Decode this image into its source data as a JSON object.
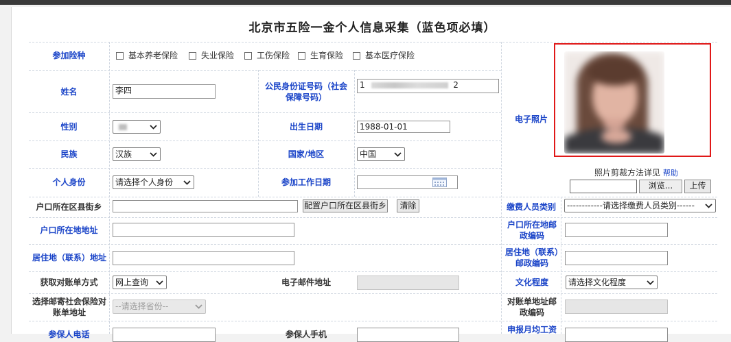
{
  "title": "北京市五险一金个人信息采集（蓝色项必填）",
  "insurance": {
    "label": "参加险种",
    "options": [
      "基本养老保险",
      "失业保险",
      "工伤保险",
      "生育保险",
      "基本医疗保险"
    ]
  },
  "name": {
    "label": "姓名",
    "value": "李四"
  },
  "id_number": {
    "label": "公民身份证号码（社会保障号码）",
    "value_start": "1",
    "value_end": "2"
  },
  "photo": {
    "label": "电子照片",
    "crop_hint": "照片剪裁方法详见",
    "help": "帮助",
    "browse": "浏览...",
    "upload": "上传"
  },
  "gender": {
    "label": "性别",
    "value": ""
  },
  "birth_date": {
    "label": "出生日期",
    "value": "1988-01-01"
  },
  "ethnicity": {
    "label": "民族",
    "value": "汉族"
  },
  "country": {
    "label": "国家/地区",
    "value": "中国"
  },
  "identity": {
    "label": "个人身份",
    "value": "请选择个人身份"
  },
  "work_start": {
    "label": "参加工作日期",
    "value": ""
  },
  "hukou_district": {
    "label": "户口所在区县街乡",
    "config_button": "配置户口所在区县街乡",
    "clear_button": "清除"
  },
  "payer_type": {
    "label": "缴费人员类别",
    "value": "------------请选择缴费人员类别------"
  },
  "hukou_address": {
    "label": "户口所在地地址"
  },
  "hukou_postcode": {
    "label": "户口所在地邮政编码"
  },
  "residence_address": {
    "label": "居住地（联系）地址"
  },
  "residence_postcode": {
    "label": "居住地（联系）邮政编码"
  },
  "statement_method": {
    "label": "获取对账单方式",
    "value": "网上查询"
  },
  "email": {
    "label": "电子邮件地址"
  },
  "education": {
    "label": "文化程度",
    "value": "请选择文化程度"
  },
  "mail_address": {
    "label": "选择邮寄社会保险对账单地址",
    "value": "--请选择省份--"
  },
  "statement_postcode": {
    "label": "对账单地址邮政编码"
  },
  "row_cut_left": {
    "label": "参保人电话"
  },
  "row_cut_mid": {
    "label": "参保人手机"
  },
  "row_cut_right": {
    "label": "申报月均工资"
  }
}
